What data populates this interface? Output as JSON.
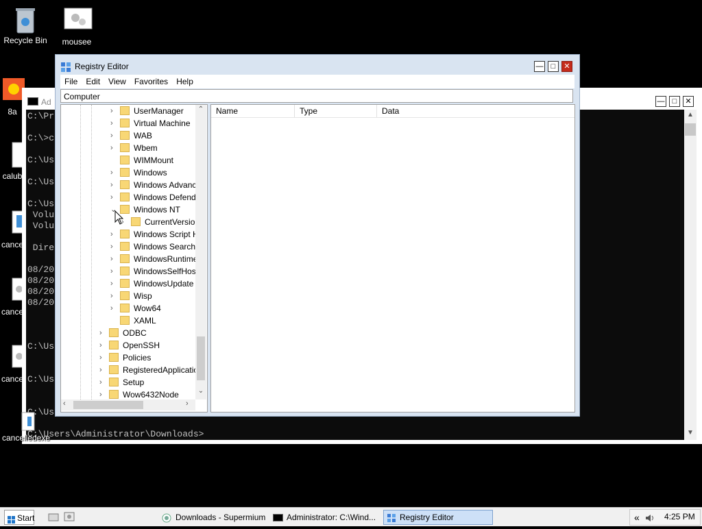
{
  "desktop": {
    "icons": [
      {
        "label": "Recycle Bin"
      },
      {
        "label": "mousee"
      },
      {
        "label": "8a"
      },
      {
        "label": "calub"
      },
      {
        "label": "cance"
      },
      {
        "label": "cance"
      },
      {
        "label": "cance"
      },
      {
        "label": "cancelledexe"
      }
    ]
  },
  "cmd": {
    "title": "Ad",
    "lines": [
      "C:\\Pr",
      "C:\\>c",
      "C:\\Us",
      "C:\\Us",
      "C:\\Us",
      " Volu",
      " Volu",
      " Dire",
      "08/20",
      "08/20",
      "08/20",
      "08/20",
      "C:\\Us",
      "C:\\Us",
      "C:\\Us",
      "C:\\Users\\Administrator\\Downloads>"
    ]
  },
  "regedit": {
    "title": "Registry Editor",
    "menu": [
      "File",
      "Edit",
      "View",
      "Favorites",
      "Help"
    ],
    "address": "Computer",
    "tree": [
      {
        "name": "UserManager",
        "chev": "›"
      },
      {
        "name": "Virtual Machine",
        "chev": "›"
      },
      {
        "name": "WAB",
        "chev": "›"
      },
      {
        "name": "Wbem",
        "chev": "›"
      },
      {
        "name": "WIMMount",
        "chev": ""
      },
      {
        "name": "Windows",
        "chev": "›"
      },
      {
        "name": "Windows Advanc",
        "chev": "›"
      },
      {
        "name": "Windows Defend",
        "chev": "›"
      },
      {
        "name": "Windows NT",
        "chev": "⌄"
      },
      {
        "name": "CurrentVersion",
        "chev": "›"
      },
      {
        "name": "Windows Script H",
        "chev": "›"
      },
      {
        "name": "Windows Search",
        "chev": "›"
      },
      {
        "name": "WindowsRuntime",
        "chev": "›"
      },
      {
        "name": "WindowsSelfHost",
        "chev": "›"
      },
      {
        "name": "WindowsUpdate",
        "chev": "›"
      },
      {
        "name": "Wisp",
        "chev": "›"
      },
      {
        "name": "Wow64",
        "chev": "›"
      },
      {
        "name": "XAML",
        "chev": ""
      },
      {
        "name": "ODBC",
        "chev": "›"
      },
      {
        "name": "OpenSSH",
        "chev": "›"
      },
      {
        "name": "Policies",
        "chev": "›"
      },
      {
        "name": "RegisteredApplicatio",
        "chev": "›"
      },
      {
        "name": "Setup",
        "chev": "›"
      },
      {
        "name": "Wow6432Node",
        "chev": "›"
      }
    ],
    "columns": [
      "Name",
      "Type",
      "Data"
    ]
  },
  "taskbar": {
    "start": "Start",
    "items": [
      {
        "label": "Downloads - Supermium"
      },
      {
        "label": "Administrator: C:\\Wind..."
      },
      {
        "label": "Registry Editor"
      }
    ],
    "clock": "4:25 PM",
    "tray_chevron": "«"
  }
}
